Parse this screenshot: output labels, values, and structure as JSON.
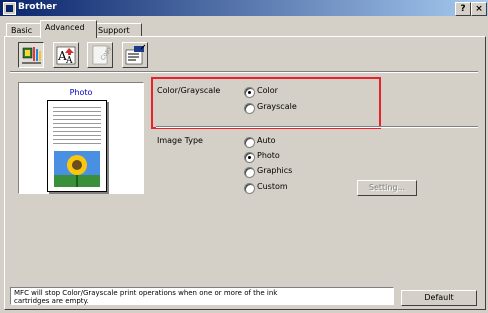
{
  "window": {
    "title": "Brother",
    "help_label": "?",
    "close_label": "×"
  },
  "tabs": [
    {
      "label": "Basic"
    },
    {
      "label": "Advanced"
    },
    {
      "label": "Support"
    }
  ],
  "toolbar": {
    "icons": [
      "color-print-icon",
      "watermark-text-icon",
      "copy-icon",
      "device-options-icon"
    ]
  },
  "preview": {
    "title": "Photo"
  },
  "color_grayscale": {
    "label": "Color/Grayscale",
    "options": [
      "Color",
      "Grayscale"
    ],
    "selected": "Color"
  },
  "image_type": {
    "label": "Image Type",
    "options": [
      "Auto",
      "Photo",
      "Graphics",
      "Custom"
    ],
    "selected": "Photo",
    "setting_button": "Setting..."
  },
  "status_text": "MFC will stop Color/Grayscale print operations when one or more of the ink\ncartridges are empty.",
  "default_button": "Default",
  "colors": {
    "highlight": "#e8212b",
    "title_bar": "#0a246a",
    "preview_title": "#0000c0"
  }
}
